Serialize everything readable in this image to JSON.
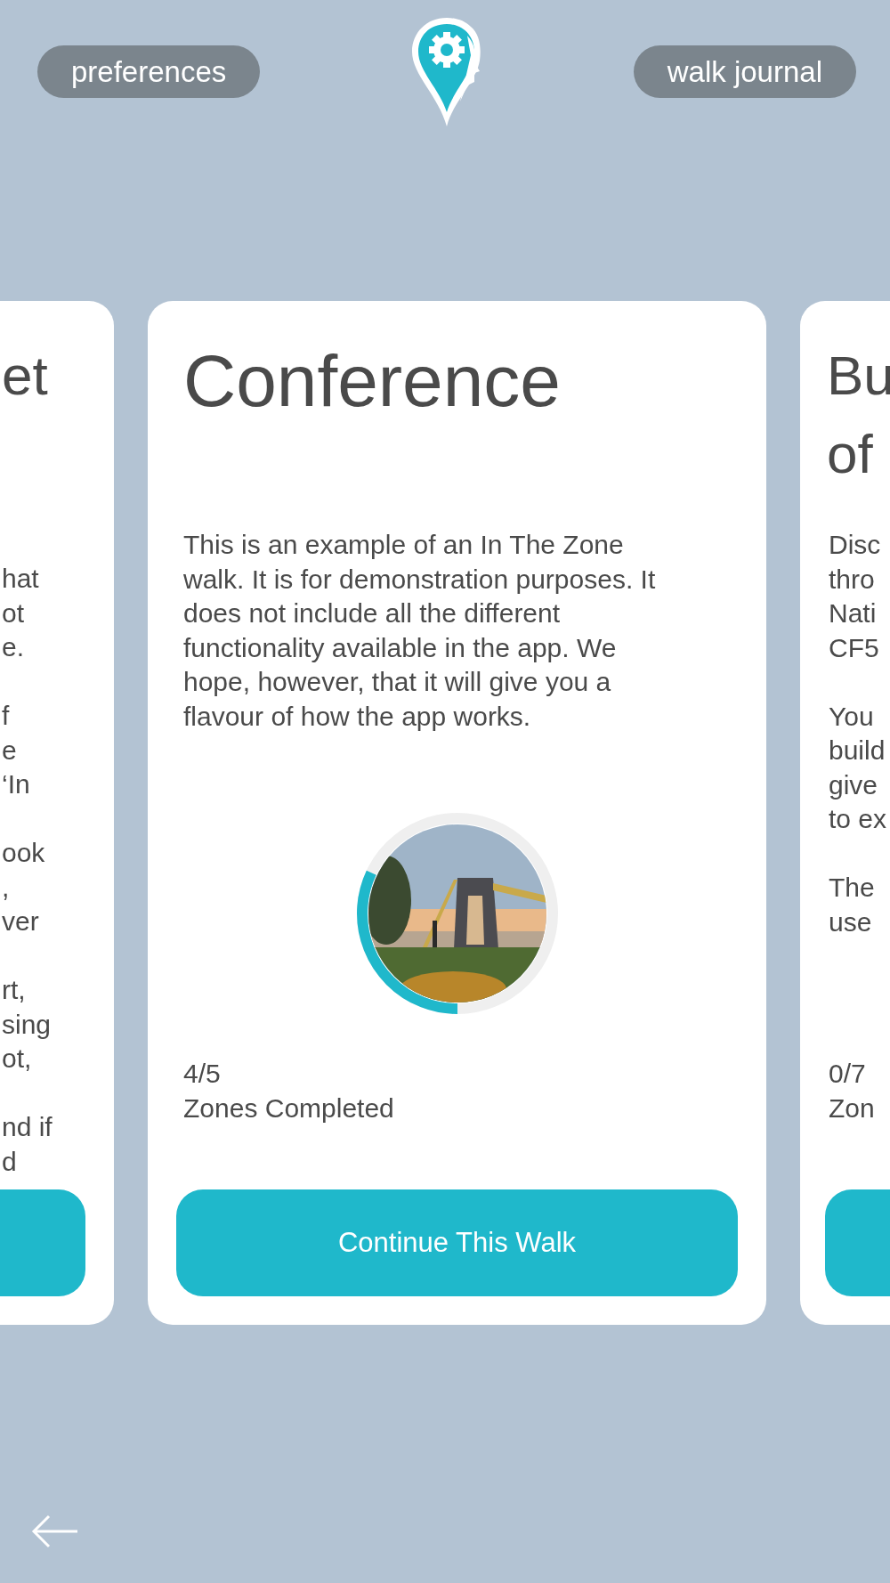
{
  "header": {
    "left_button": "preferences",
    "right_button": "walk journal"
  },
  "cards": [
    {
      "kind": "partial_left",
      "title_lines": [
        "et"
      ],
      "paragraphs": [
        [
          "hat",
          "ot",
          "e."
        ],
        [
          "f",
          "e",
          "‘In"
        ],
        [
          "ook",
          ",",
          "ver"
        ],
        [
          "rt,",
          "sing",
          "ot,"
        ],
        [
          "nd if",
          "d"
        ]
      ]
    },
    {
      "kind": "full",
      "title_lines": [
        "Conference"
      ],
      "paragraphs": [
        [
          "This is an example of an In The Zone walk. It is for demonstration purposes. It does not include all the different functionality available in the app. We hope, however, that it will give you a flavour of how the app works."
        ]
      ],
      "progress": {
        "level": 0.32,
        "count": "4/5",
        "label": "Zones Completed"
      },
      "button": "Continue This Walk"
    },
    {
      "kind": "partial_right",
      "title_lines": [
        "Bu",
        "of"
      ],
      "paragraphs": [
        [
          "Disc",
          "thro",
          "Nati",
          "CF5"
        ],
        [
          "You",
          "build",
          "give",
          "to ex"
        ],
        [
          "The",
          "use"
        ]
      ],
      "progress": {
        "count": "0/7",
        "label": "Zon"
      }
    }
  ]
}
